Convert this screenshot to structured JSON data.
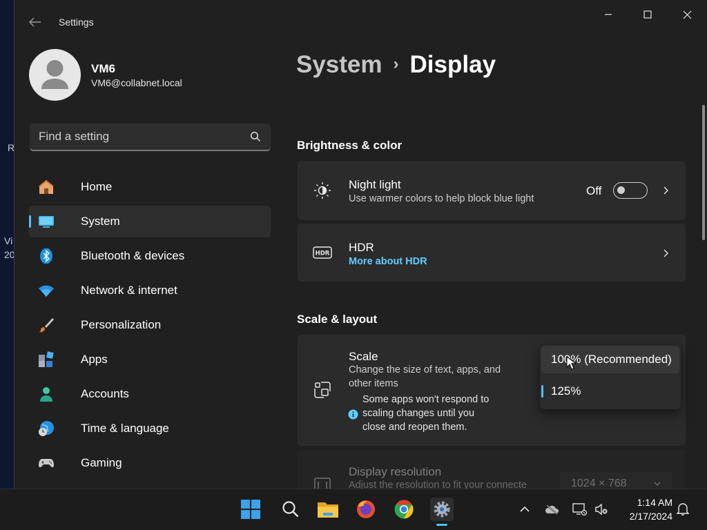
{
  "desktop": {
    "fragments": [
      "R",
      "Vi",
      "20"
    ]
  },
  "window": {
    "title": "Settings",
    "controls": {
      "minimize": "minimize",
      "maximize": "maximize",
      "close": "close"
    }
  },
  "user": {
    "name": "VM6",
    "email": "VM6@collabnet.local"
  },
  "search": {
    "placeholder": "Find a setting"
  },
  "nav": {
    "items": [
      {
        "label": "Home",
        "icon": "home-icon"
      },
      {
        "label": "System",
        "icon": "system-icon"
      },
      {
        "label": "Bluetooth & devices",
        "icon": "bluetooth-icon"
      },
      {
        "label": "Network & internet",
        "icon": "network-icon"
      },
      {
        "label": "Personalization",
        "icon": "brush-icon"
      },
      {
        "label": "Apps",
        "icon": "apps-icon"
      },
      {
        "label": "Accounts",
        "icon": "accounts-icon"
      },
      {
        "label": "Time & language",
        "icon": "time-language-icon"
      },
      {
        "label": "Gaming",
        "icon": "gaming-icon"
      }
    ],
    "active": "System"
  },
  "breadcrumb": {
    "parent": "System",
    "separator": "›",
    "current": "Display"
  },
  "sections": {
    "brightness": {
      "title": "Brightness & color",
      "night_light": {
        "title": "Night light",
        "desc": "Use warmer colors to help block blue light",
        "toggle_label": "Off"
      },
      "hdr": {
        "title": "HDR",
        "link": "More about HDR"
      }
    },
    "scale_layout": {
      "title": "Scale & layout",
      "scale": {
        "title": "Scale",
        "desc_line1": "Change the size of text, apps, and",
        "desc_line2": "other items",
        "note_line1": "Some apps won't respond to",
        "note_line2": "scaling changes until you",
        "note_line3": "close and reopen them.",
        "options": [
          "100% (Recommended)",
          "125%"
        ],
        "selected": "125%"
      },
      "resolution": {
        "title": "Display resolution",
        "desc": "Adjust the resolution to fit your connecte",
        "value": "1024 × 768"
      }
    }
  },
  "taskbar": {
    "apps": [
      "start-icon",
      "search-icon",
      "file-explorer-icon",
      "firefox-icon",
      "chrome-icon",
      "settings-icon"
    ],
    "clock": {
      "time": "1:14 AM",
      "date": "2/17/2024"
    }
  },
  "colors": {
    "accent": "#4cc2ff",
    "link": "#60cdff",
    "window_bg": "#202020",
    "card_bg": "#2b2b2b"
  }
}
